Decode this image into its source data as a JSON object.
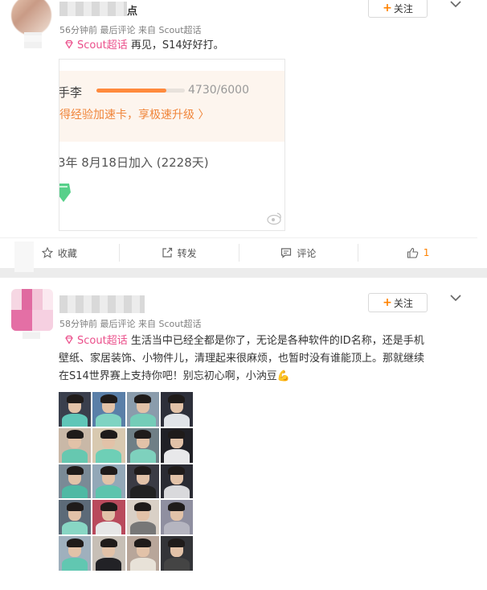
{
  "posts": [
    {
      "username_visible": "点",
      "meta": "56分钟前 最后评论 来自 Scout超话",
      "follow_label": "关注",
      "chaohua_tag": "Scout超话",
      "body": "再见，S14好好打。",
      "embed": {
        "name_fragment": "手李",
        "progress_text": "4730/6000",
        "progress_fraction": 0.79,
        "upgrade_text": "得经验加速卡，享极速升级 〉",
        "joined_text": "3年 8月18日加入 (2228天)"
      },
      "actions": [
        {
          "label": "收藏",
          "icon": "star-icon"
        },
        {
          "label": "转发",
          "icon": "repost-icon"
        },
        {
          "label": "评论",
          "icon": "comment-icon"
        },
        {
          "label": "1",
          "icon": "thumbs-up-icon"
        }
      ]
    },
    {
      "meta": "58分钟前 最后评论 来自 Scout超话",
      "follow_label": "关注",
      "chaohua_tag": "Scout超话",
      "body_lines": [
        "生活当中已经全都是你了，无论是各种软件的ID名称，还是手机",
        "壁纸、家居装饰、小物件儿，清理起来很麻烦，也暂时没有谁能顶上。那就继续",
        "在S14世界赛上支持你吧！别忘初心啊，小汭豆💪"
      ],
      "photo_count": 20
    }
  ],
  "colors": {
    "accent_orange": "#ff8200",
    "chaohua_pink": "#eb4f8b",
    "meta_grey": "#808080",
    "like_orange": "#ff8200"
  }
}
